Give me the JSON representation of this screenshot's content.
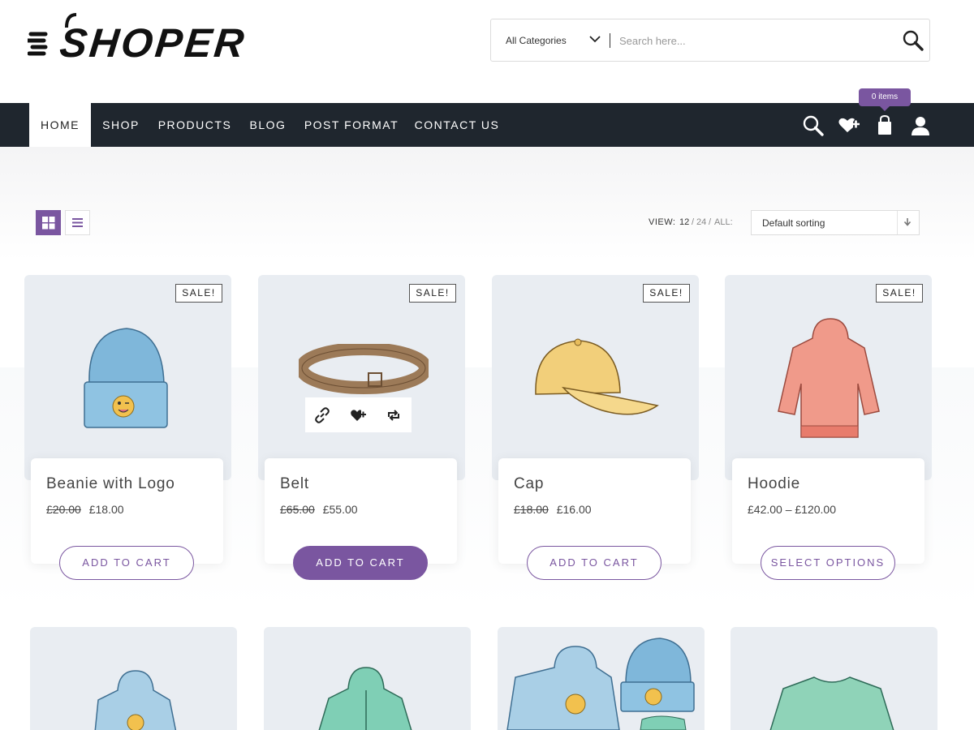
{
  "brand": {
    "name": "SHOPER"
  },
  "search": {
    "category": "All Categories",
    "placeholder": "Search here..."
  },
  "nav": {
    "items": [
      "HOME",
      "SHOP",
      "PRODUCTS",
      "BLOG",
      "POST FORMAT",
      "CONTACT US"
    ],
    "active": "HOME",
    "cart_badge": "0 items"
  },
  "toolbar": {
    "view_label": "VIEW:",
    "view_options": [
      "12",
      "24",
      "ALL:"
    ],
    "view_separator": "/",
    "sort": "Default sorting"
  },
  "products": [
    {
      "title": "Beanie with Logo",
      "old_price": "£20.00",
      "price": "£18.00",
      "badge": "SALE!",
      "button": "ADD TO CART"
    },
    {
      "title": "Belt",
      "old_price": "£65.00",
      "price": "£55.00",
      "badge": "SALE!",
      "button": "ADD TO CART"
    },
    {
      "title": "Cap",
      "old_price": "£18.00",
      "price": "£16.00",
      "badge": "SALE!",
      "button": "ADD TO CART"
    },
    {
      "title": "Hoodie",
      "old_price": "",
      "price": "£42.00 – £120.00",
      "badge": "SALE!",
      "button": "SELECT OPTIONS"
    }
  ],
  "colors": {
    "accent": "#7a56a0",
    "nav_bg": "#1f262e",
    "card_bg": "#e9edf2"
  },
  "icons": {
    "search": "magnifier-icon",
    "wishlist": "heart-plus-icon",
    "cart": "shopping-bag-icon",
    "account": "user-icon",
    "grid_view": "grid-icon",
    "list_view": "list-icon",
    "quick_view": "link-icon",
    "compare": "repeat-icon"
  }
}
